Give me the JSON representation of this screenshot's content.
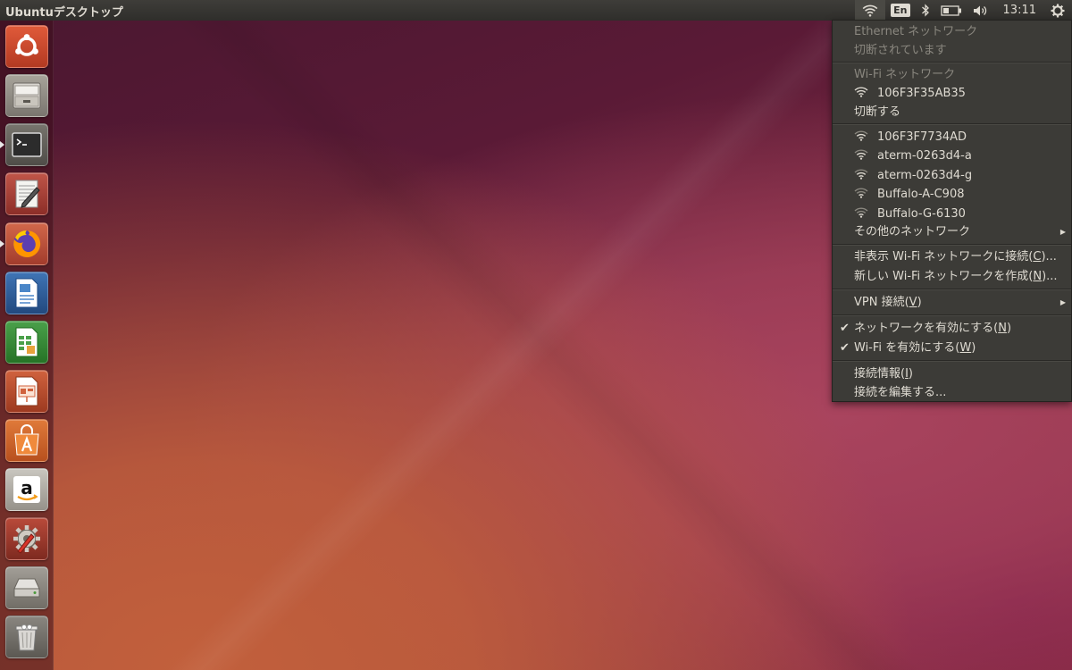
{
  "panel": {
    "app_title": "Ubuntuデスクトップ",
    "lang_indicator": "En",
    "clock": "13:11"
  },
  "launcher": {
    "items": [
      {
        "name": "ubuntu-dash-icon",
        "running": false
      },
      {
        "name": "files-icon",
        "running": false
      },
      {
        "name": "terminal-icon",
        "running": true
      },
      {
        "name": "text-editor-icon",
        "running": false
      },
      {
        "name": "firefox-icon",
        "running": true
      },
      {
        "name": "libreoffice-writer-icon",
        "running": false
      },
      {
        "name": "libreoffice-calc-icon",
        "running": false
      },
      {
        "name": "libreoffice-impress-icon",
        "running": false
      },
      {
        "name": "software-center-icon",
        "running": false
      },
      {
        "name": "amazon-icon",
        "running": false
      },
      {
        "name": "system-settings-icon",
        "running": false
      },
      {
        "name": "disk-drive-icon",
        "running": false
      },
      {
        "name": "trash-icon",
        "running": false
      }
    ]
  },
  "network_menu": {
    "ethernet_header": "Ethernet ネットワーク",
    "ethernet_status": "切断されています",
    "wifi_header": "Wi-Fi ネットワーク",
    "connected_network": "106F3F35AB35",
    "disconnect": "切断する",
    "networks": [
      "106F3F7734AD",
      "aterm-0263d4-a",
      "aterm-0263d4-g",
      "Buffalo-A-C908",
      "Buffalo-G-6130"
    ],
    "other_networks": "その他のネットワーク",
    "connect_hidden_pre": "非表示 Wi-Fi ネットワークに接続(",
    "connect_hidden_key": "C",
    "connect_hidden_post": ")...",
    "create_new_pre": "新しい Wi-Fi ネットワークを作成(",
    "create_new_key": "N",
    "create_new_post": ")...",
    "vpn_pre": "VPN 接続(",
    "vpn_key": "V",
    "vpn_post": ")",
    "enable_networking_pre": "ネットワークを有効にする(",
    "enable_networking_key": "N",
    "enable_networking_post": ")",
    "enable_wifi_pre": "Wi-Fi を有効にする(",
    "enable_wifi_key": "W",
    "enable_wifi_post": ")",
    "connection_info_pre": "接続情報(",
    "connection_info_key": "I",
    "connection_info_post": ")",
    "edit_connections": "接続を編集する...",
    "check_glyph": "✔",
    "submenu_arrow": "▶"
  },
  "colors": {
    "panel_bg": "#2f2e2b",
    "menu_bg": "#3c3b37",
    "menu_text": "#dfdbd2",
    "menu_disabled": "#8a877f"
  }
}
